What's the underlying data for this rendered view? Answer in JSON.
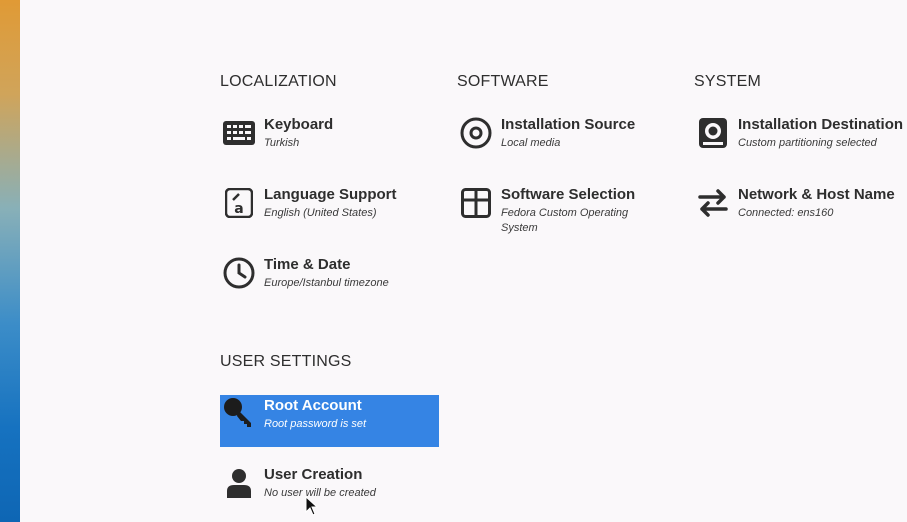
{
  "localization": {
    "heading": "LOCALIZATION",
    "keyboard": {
      "title": "Keyboard",
      "status": "Turkish",
      "icon": "keyboard-icon"
    },
    "language": {
      "title": "Language Support",
      "status": "English (United States)",
      "icon": "language-icon"
    },
    "time": {
      "title": "Time & Date",
      "status": "Europe/Istanbul timezone",
      "icon": "clock-icon"
    }
  },
  "software": {
    "heading": "SOFTWARE",
    "source": {
      "title": "Installation Source",
      "status": "Local media",
      "icon": "disc-icon"
    },
    "selection": {
      "title": "Software Selection",
      "status_line1": "Fedora Custom Operating",
      "status_line2": "System",
      "icon": "package-icon"
    }
  },
  "system": {
    "heading": "SYSTEM",
    "destination": {
      "title": "Installation Destination",
      "status": "Custom partitioning selected",
      "icon": "drive-icon"
    },
    "network": {
      "title": "Network & Host Name",
      "status": "Connected: ens160",
      "icon": "network-arrows-icon"
    }
  },
  "user_settings": {
    "heading": "USER SETTINGS",
    "root": {
      "title": "Root Account",
      "status": "Root password is set",
      "icon": "key-icon"
    },
    "user": {
      "title": "User Creation",
      "status": "No user will be created",
      "icon": "person-icon"
    }
  },
  "colors": {
    "selected_background": "#3584e4",
    "text": "#2e2e2e"
  }
}
